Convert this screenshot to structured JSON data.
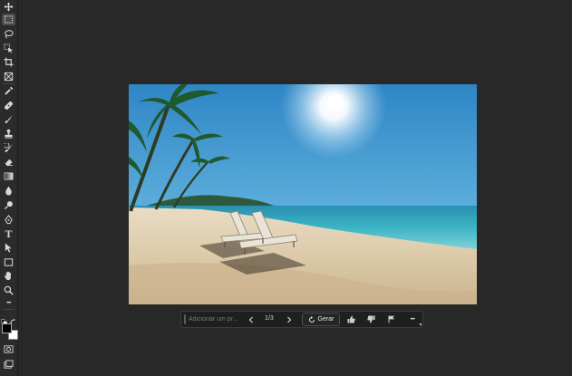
{
  "toolbar": {
    "tools": [
      {
        "name": "move-tool-icon"
      },
      {
        "name": "rectangular-marquee-icon",
        "selected": true
      },
      {
        "name": "lasso-icon"
      },
      {
        "name": "object-selection-icon"
      },
      {
        "name": "crop-icon"
      },
      {
        "name": "frame-icon"
      },
      {
        "name": "eyedropper-icon"
      },
      {
        "name": "spot-healing-brush-icon"
      },
      {
        "name": "brush-icon"
      },
      {
        "name": "clone-stamp-icon"
      },
      {
        "name": "history-brush-icon"
      },
      {
        "name": "eraser-icon"
      },
      {
        "name": "gradient-icon"
      },
      {
        "name": "blur-icon"
      },
      {
        "name": "dodge-icon"
      },
      {
        "name": "pen-icon"
      },
      {
        "name": "type-icon"
      },
      {
        "name": "path-selection-icon"
      },
      {
        "name": "rectangle-icon"
      },
      {
        "name": "hand-icon"
      },
      {
        "name": "zoom-icon"
      }
    ],
    "type_glyph": "T",
    "more_glyph": "•••",
    "foreground_color": "#000000",
    "background_color": "#ffffff"
  },
  "canvas": {
    "image_subject": "tropical-beach-photo"
  },
  "contextual_task_bar": {
    "prompt_placeholder": "Adicionar um pr...",
    "prompt_value": "",
    "counter": "1/3",
    "generate_label": "Gerar",
    "more_glyph": "•••"
  }
}
